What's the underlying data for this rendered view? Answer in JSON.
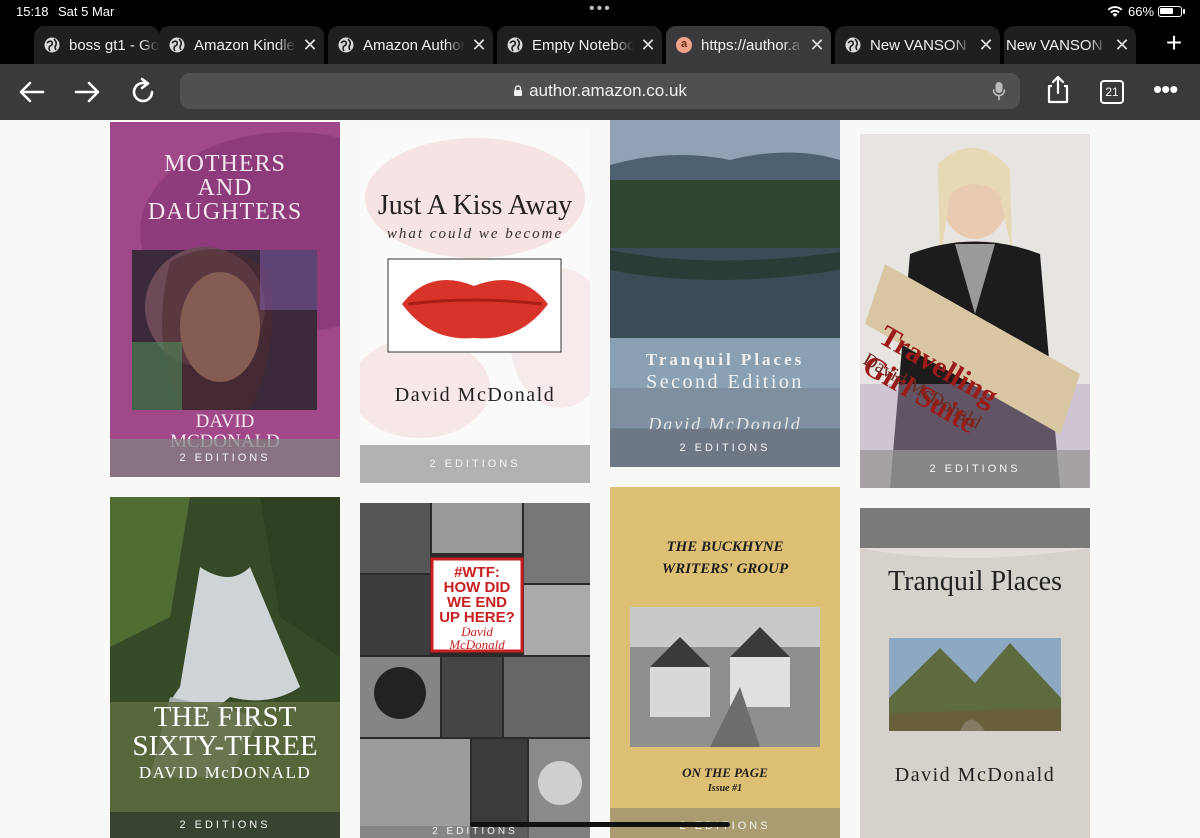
{
  "status": {
    "time": "15:18",
    "date": "Sat 5 Mar",
    "battery": "66%",
    "battery_level": 0.66
  },
  "tabs": [
    {
      "title": "boss gt1 - Go",
      "icon": "globe-icon",
      "active": false,
      "close": ""
    },
    {
      "title": "Amazon Kindle",
      "icon": "globe-icon",
      "active": false,
      "close": "✕"
    },
    {
      "title": "Amazon Author",
      "icon": "globe-icon",
      "active": false,
      "close": "✕"
    },
    {
      "title": "Empty Noteboo",
      "icon": "globe-icon",
      "active": false,
      "close": "✕"
    },
    {
      "title": "https://author.a",
      "icon": "amazon-a-icon",
      "active": true,
      "close": "✕"
    },
    {
      "title": "New VANSON V",
      "icon": "globe-icon",
      "active": false,
      "close": "✕"
    },
    {
      "title": "New VANSON V",
      "icon": "",
      "active": false,
      "close": "✕"
    }
  ],
  "toolbar": {
    "url": "author.amazon.co.uk",
    "tab_count": "21",
    "new_tab": "+",
    "more": "•••"
  },
  "books": [
    {
      "title_line1": "MOTHERS",
      "title_line2": "AND",
      "title_line3": "DAUGHTERS",
      "author_line1": "DAVID",
      "author_line2": "MCDONALD",
      "editions": "2 EDITIONS"
    },
    {
      "title": "Just A Kiss Away",
      "subtitle": "what could we become",
      "author": "David McDonald",
      "editions": "2 EDITIONS"
    },
    {
      "title_line1": "Tranquil Places",
      "title_line2": "Second Edition",
      "author": "David McDonald",
      "editions": "2 EDITIONS"
    },
    {
      "title_line1": "Travelling",
      "title_line2": "Girl Suite",
      "author": "David McDonald",
      "editions": "2 EDITIONS"
    },
    {
      "title_line1": "THE FIRST",
      "title_line2": "SIXTY-THREE",
      "author": "DAVID McDONALD",
      "editions": "2 EDITIONS"
    },
    {
      "title_line1": "#WTF:",
      "title_line2": "HOW DID",
      "title_line3": "WE END",
      "title_line4": "UP HERE?",
      "author_line1": "David",
      "author_line2": "McDonald",
      "editions": "2 EDITIONS"
    },
    {
      "title_line1": "THE BUCKHYNE",
      "title_line2": "WRITERS' GROUP",
      "subtitle": "ON THE PAGE",
      "issue": "Issue #1",
      "editions": "2 EDITIONS"
    },
    {
      "title": "Tranquil Places",
      "author": "David McDonald",
      "editions": ""
    }
  ]
}
